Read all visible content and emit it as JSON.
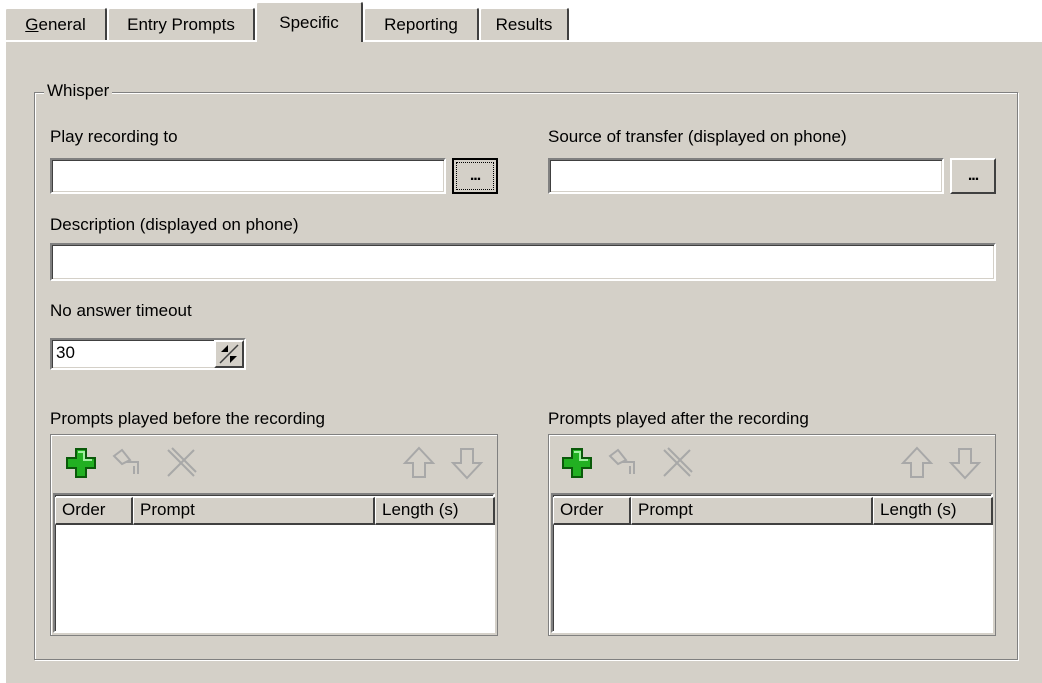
{
  "tabs": [
    {
      "label_u": "G",
      "label_rest": "eneral"
    },
    {
      "label": "Entry Prompts"
    },
    {
      "label": "Specific"
    },
    {
      "label": "Reporting"
    },
    {
      "label": "Results"
    }
  ],
  "active_tab": "Specific",
  "group_title": "Whisper",
  "play_recording": {
    "label": "Play recording to",
    "value": "",
    "browse_label": "..."
  },
  "source_transfer": {
    "label": "Source of transfer (displayed on phone)",
    "value": "",
    "browse_label": "..."
  },
  "description": {
    "label": "Description (displayed on phone)",
    "value": ""
  },
  "no_answer": {
    "label": "No answer timeout",
    "value": "30"
  },
  "before_list": {
    "title": "Prompts played before the recording",
    "toolbar_icons": [
      "add-icon",
      "edit-icon",
      "delete-icon",
      "move-up-icon",
      "move-down-icon"
    ],
    "columns": [
      "Order",
      "Prompt",
      "Length (s)"
    ],
    "rows": []
  },
  "after_list": {
    "title": "Prompts played after the recording",
    "toolbar_icons": [
      "add-icon",
      "edit-icon",
      "delete-icon",
      "move-up-icon",
      "move-down-icon"
    ],
    "columns": [
      "Order",
      "Prompt",
      "Length (s)"
    ],
    "rows": []
  },
  "colors": {
    "face": "#d4d0c8",
    "add_icon": "#22b022",
    "disabled_icon": "#a8a8a8"
  }
}
